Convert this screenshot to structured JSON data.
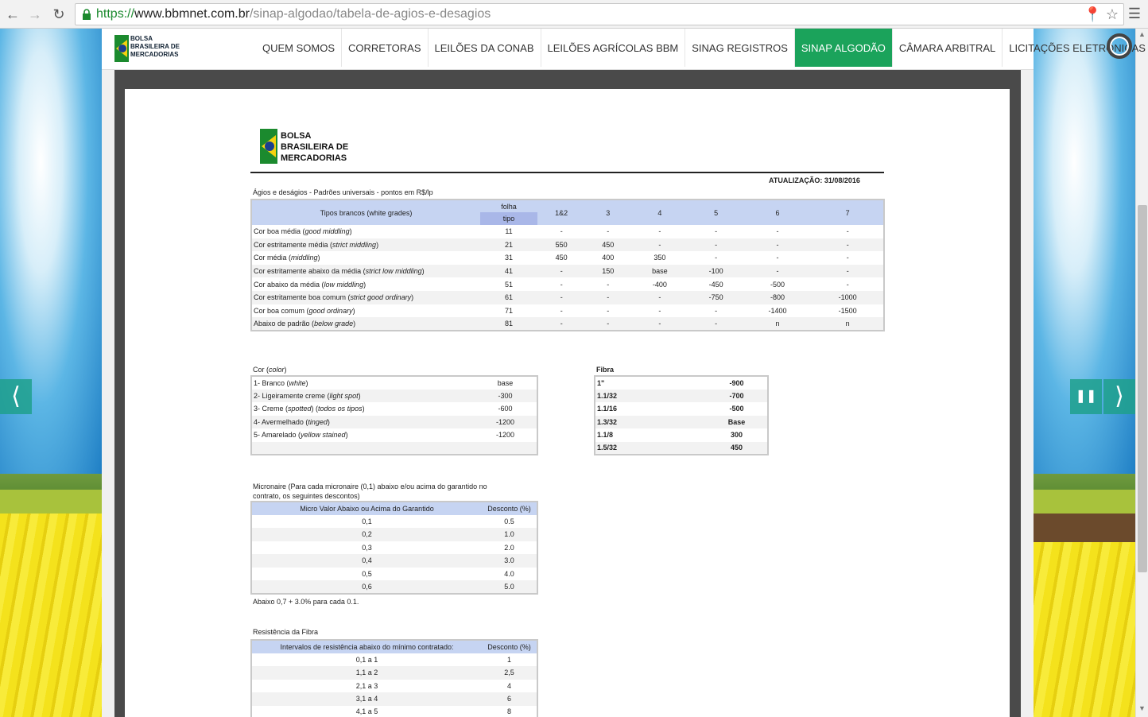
{
  "browser": {
    "url_scheme": "https://",
    "url_host": "www.bbmnet.com.br",
    "url_path": "/sinap-algodao/tabela-de-agios-e-desagios"
  },
  "site": {
    "logo_lines": [
      "BOLSA",
      "BRASILEIRA DE",
      "MERCADORIAS"
    ],
    "nav": [
      {
        "label": "QUEM SOMOS",
        "active": false
      },
      {
        "label": "CORRETORAS",
        "active": false
      },
      {
        "label": "LEILÕES DA CONAB",
        "active": false
      },
      {
        "label": "LEILÕES AGRÍCOLAS BBM",
        "active": false
      },
      {
        "label": "SINAG REGISTROS",
        "active": false
      },
      {
        "label": "SINAP ALGODÃO",
        "active": true
      },
      {
        "label": "CÂMARA ARBITRAL",
        "active": false
      },
      {
        "label": "LICITAÇÕES ELETRÔNICAS",
        "active": false,
        "dropdown": true
      }
    ],
    "accent_color": "#1ba35b"
  },
  "doc": {
    "logo_lines": [
      "BOLSA",
      "BRASILEIRA DE",
      "MERCADORIAS"
    ],
    "update": "ATUALIZAÇÃO: 31/08/2016",
    "subtitle": "Ágios e deságios - Padrões universais - pontos em R$/lp",
    "main_table": {
      "header_label": "Tipos brancos (white grades)",
      "folha": "folha",
      "tipo": "tipo",
      "columns": [
        "1&2",
        "3",
        "4",
        "5",
        "6",
        "7"
      ],
      "rows": [
        {
          "pt": "Cor boa média (",
          "en": "good middling",
          "tipo": "11",
          "values": [
            "-",
            "-",
            "-",
            "-",
            "-",
            "-"
          ]
        },
        {
          "pt": "Cor estritamente média (",
          "en": "strict middling",
          "tipo": "21",
          "values": [
            "550",
            "450",
            "-",
            "-",
            "-",
            "-"
          ]
        },
        {
          "pt": "Cor média (",
          "en": "middling",
          "tipo": "31",
          "values": [
            "450",
            "400",
            "350",
            "-",
            "-",
            "-"
          ]
        },
        {
          "pt": "Cor estritamente abaixo da média (",
          "en": "strict low middling",
          "tipo": "41",
          "values": [
            "-",
            "150",
            "base",
            "-100",
            "-",
            "-"
          ]
        },
        {
          "pt": "Cor abaixo da média (",
          "en": "low middling",
          "tipo": "51",
          "values": [
            "-",
            "-",
            "-400",
            "-450",
            "-500",
            "-"
          ]
        },
        {
          "pt": "Cor estritamente boa comum (",
          "en": "strict good ordinary",
          "tipo": "61",
          "values": [
            "-",
            "-",
            "-",
            "-750",
            "-800",
            "-1000"
          ]
        },
        {
          "pt": "Cor boa comum (",
          "en": "good ordinary",
          "tipo": "71",
          "values": [
            "-",
            "-",
            "-",
            "-",
            "-1400",
            "-1500"
          ]
        },
        {
          "pt": "Abaixo de padrão (",
          "en": "below grade",
          "tipo": "81",
          "values": [
            "-",
            "-",
            "-",
            "-",
            "n",
            "n"
          ]
        }
      ]
    },
    "color": {
      "title_pt": "Cor (",
      "title_en": "color",
      "rows": [
        {
          "pt": "1- Branco (",
          "en": "white",
          "extra": "",
          "value": "base"
        },
        {
          "pt": "2- Ligeiramente creme (",
          "en": "light spot",
          "extra": "",
          "value": "-300"
        },
        {
          "pt": "3- Creme (",
          "en": "spotted",
          "extra": "todos os tipos",
          "value": "-600"
        },
        {
          "pt": "4- Avermelhado (",
          "en": "tinged",
          "extra": "",
          "value": "-1200"
        },
        {
          "pt": "5- Amarelado (",
          "en": "yellow stained",
          "extra": "",
          "value": "-1200"
        }
      ]
    },
    "fibra": {
      "title": "Fibra",
      "rows": [
        {
          "label": "1\"",
          "value": "-900"
        },
        {
          "label": "1.1/32",
          "value": "-700"
        },
        {
          "label": "1.1/16",
          "value": "-500"
        },
        {
          "label": "1.3/32",
          "value": "Base"
        },
        {
          "label": "1.1/8",
          "value": "300"
        },
        {
          "label": "1.5/32",
          "value": "450"
        }
      ]
    },
    "micronaire": {
      "title": "Micronaire (Para cada micronaire (0,1) abaixo e/ou acima do garantido no contrato, os seguintes descontos)",
      "col1": "Micro Valor Abaixo ou Acima do Garantido",
      "col2": "Desconto (%)",
      "rows": [
        [
          "0,1",
          "0.5"
        ],
        [
          "0,2",
          "1.0"
        ],
        [
          "0,3",
          "2.0"
        ],
        [
          "0,4",
          "3.0"
        ],
        [
          "0,5",
          "4.0"
        ],
        [
          "0,6",
          "5.0"
        ]
      ],
      "note": "Abaixo 0,7 + 3.0% para cada 0.1."
    },
    "resistencia": {
      "title": "Resistência da Fibra",
      "col1": "Intervalos de resistência abaixo do mínimo contratado:",
      "col2": "Desconto (%)",
      "rows": [
        [
          "0,1 a 1",
          "1"
        ],
        [
          "1,1 a 2",
          "2,5"
        ],
        [
          "2,1 a 3",
          "4"
        ],
        [
          "3,1 a 4",
          "6"
        ],
        [
          "4,1 a 5",
          "8"
        ]
      ]
    }
  }
}
